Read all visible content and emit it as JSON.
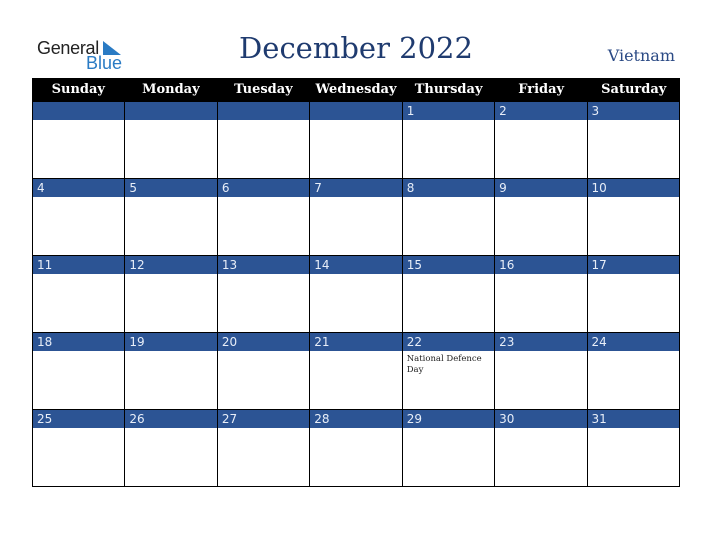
{
  "logo": {
    "general": "General",
    "blue": "Blue"
  },
  "title": "December 2022",
  "country": "Vietnam",
  "colors": {
    "header_bg": "#000000",
    "day_bar": "#2c5494",
    "title": "#1f3b6f"
  },
  "weekdays": [
    "Sunday",
    "Monday",
    "Tuesday",
    "Wednesday",
    "Thursday",
    "Friday",
    "Saturday"
  ],
  "weeks": [
    [
      {
        "day": "",
        "event": ""
      },
      {
        "day": "",
        "event": ""
      },
      {
        "day": "",
        "event": ""
      },
      {
        "day": "",
        "event": ""
      },
      {
        "day": "1",
        "event": ""
      },
      {
        "day": "2",
        "event": ""
      },
      {
        "day": "3",
        "event": ""
      }
    ],
    [
      {
        "day": "4",
        "event": ""
      },
      {
        "day": "5",
        "event": ""
      },
      {
        "day": "6",
        "event": ""
      },
      {
        "day": "7",
        "event": ""
      },
      {
        "day": "8",
        "event": ""
      },
      {
        "day": "9",
        "event": ""
      },
      {
        "day": "10",
        "event": ""
      }
    ],
    [
      {
        "day": "11",
        "event": ""
      },
      {
        "day": "12",
        "event": ""
      },
      {
        "day": "13",
        "event": ""
      },
      {
        "day": "14",
        "event": ""
      },
      {
        "day": "15",
        "event": ""
      },
      {
        "day": "16",
        "event": ""
      },
      {
        "day": "17",
        "event": ""
      }
    ],
    [
      {
        "day": "18",
        "event": ""
      },
      {
        "day": "19",
        "event": ""
      },
      {
        "day": "20",
        "event": ""
      },
      {
        "day": "21",
        "event": ""
      },
      {
        "day": "22",
        "event": "National Defence Day"
      },
      {
        "day": "23",
        "event": ""
      },
      {
        "day": "24",
        "event": ""
      }
    ],
    [
      {
        "day": "25",
        "event": ""
      },
      {
        "day": "26",
        "event": ""
      },
      {
        "day": "27",
        "event": ""
      },
      {
        "day": "28",
        "event": ""
      },
      {
        "day": "29",
        "event": ""
      },
      {
        "day": "30",
        "event": ""
      },
      {
        "day": "31",
        "event": ""
      }
    ]
  ]
}
